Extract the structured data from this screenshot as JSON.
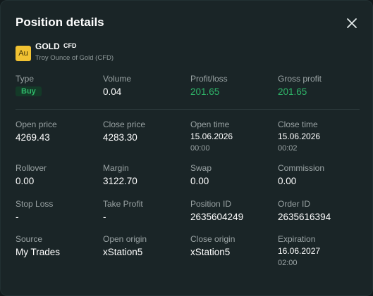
{
  "dialog": {
    "title": "Position details"
  },
  "instrument": {
    "icon_text": "Au",
    "symbol": "GOLD",
    "type": "CFD",
    "name": "Troy Ounce of Gold (CFD)",
    "icon_color": "#f1c232"
  },
  "fields": {
    "type": {
      "label": "Type",
      "value": "Buy"
    },
    "volume": {
      "label": "Volume",
      "value": "0.04"
    },
    "profit_loss": {
      "label": "Profit/loss",
      "value": "201.65"
    },
    "gross_profit": {
      "label": "Gross profit",
      "value": "201.65"
    },
    "open_price": {
      "label": "Open price",
      "value": "4269.43"
    },
    "close_price": {
      "label": "Close price",
      "value": "4283.30"
    },
    "open_time": {
      "label": "Open time",
      "date": "15.06.2026",
      "time": "00:00"
    },
    "close_time": {
      "label": "Close time",
      "date": "15.06.2026",
      "time": "00:02"
    },
    "rollover": {
      "label": "Rollover",
      "value": "0.00"
    },
    "margin": {
      "label": "Margin",
      "value": "3122.70"
    },
    "swap": {
      "label": "Swap",
      "value": "0.00"
    },
    "commission": {
      "label": "Commission",
      "value": "0.00"
    },
    "stop_loss": {
      "label": "Stop Loss",
      "value": "-"
    },
    "take_profit": {
      "label": "Take Profit",
      "value": "-"
    },
    "position_id": {
      "label": "Position ID",
      "value": "2635604249"
    },
    "order_id": {
      "label": "Order ID",
      "value": "2635616394"
    },
    "source": {
      "label": "Source",
      "value": "My Trades"
    },
    "open_origin": {
      "label": "Open origin",
      "value": "xStation5"
    },
    "close_origin": {
      "label": "Close origin",
      "value": "xStation5"
    },
    "expiration": {
      "label": "Expiration",
      "date": "16.06.2027",
      "time": "02:00"
    }
  },
  "colors": {
    "background": "#1a2527",
    "profit_green": "#2fb86a",
    "label_gray": "#9aa3a4"
  },
  "icons": {
    "close": "close-icon"
  }
}
